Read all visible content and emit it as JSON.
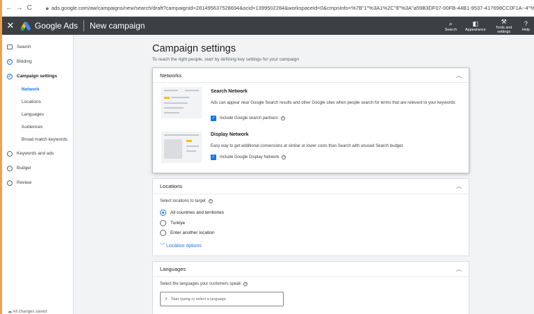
{
  "browser": {
    "back": "←",
    "forward": "→",
    "reload": "C",
    "url": "ads.google.com/aw/campaigns/new/search/draft?campaignId=281495637528694&ocid=1399502284&workspaceId=0&cmpnInfo=%7B\"1\"%3A1%2C\"8\"%3A\"a59B3DF07-00FB-44B1-9537-417698CC0F1A--4\"%2C\"18\"%3A1%2C\"28\"%3A1"
  },
  "header": {
    "brand": "Google Ads",
    "page_name": "New campaign",
    "tools": [
      {
        "label": "Search",
        "icon": "search-icon",
        "glyph": "⌕"
      },
      {
        "label": "Appearance",
        "icon": "appearance-icon",
        "glyph": "◧"
      },
      {
        "label": "Tools and settings",
        "icon": "wrench-icon",
        "glyph": "⚒"
      },
      {
        "label": "Help",
        "icon": "help-icon",
        "glyph": "?"
      }
    ]
  },
  "sidebar": {
    "steps": [
      {
        "label": "Search"
      },
      {
        "label": "Bidding"
      },
      {
        "label": "Campaign settings"
      },
      {
        "label": "Keywords and ads"
      },
      {
        "label": "Budget"
      },
      {
        "label": "Review"
      }
    ],
    "substeps": [
      "Network",
      "Locations",
      "Languages",
      "Audiences",
      "Broad match keywords"
    ],
    "saved": "All changes saved"
  },
  "main": {
    "title": "Campaign settings",
    "subtitle": "To reach the right people, start by defining key settings for your campaign",
    "networks": {
      "heading": "Networks",
      "search_title": "Search Network",
      "search_desc": "Ads can appear near Google Search results and other Google sites when people search for terms that are relevant to your keywords",
      "search_checkbox": "Include Google search partners",
      "display_title": "Display Network",
      "display_desc": "Easy way to get additional conversions at similar or lower costs than Search with unused Search budget.",
      "display_checkbox": "Include Google Display Network"
    },
    "locations": {
      "heading": "Locations",
      "label": "Select locations to target",
      "options": [
        "All countries and territories",
        "Turkiye",
        "Enter another location"
      ],
      "selected": "All countries and territories",
      "options_link": "Location options"
    },
    "languages": {
      "heading": "Languages",
      "label": "Select the languages your customers speak",
      "placeholder": "Start typing or select a language"
    }
  },
  "colors": {
    "accent": "#1a73e8",
    "header_bg": "#3c4043",
    "strip": "#e8a35a"
  }
}
